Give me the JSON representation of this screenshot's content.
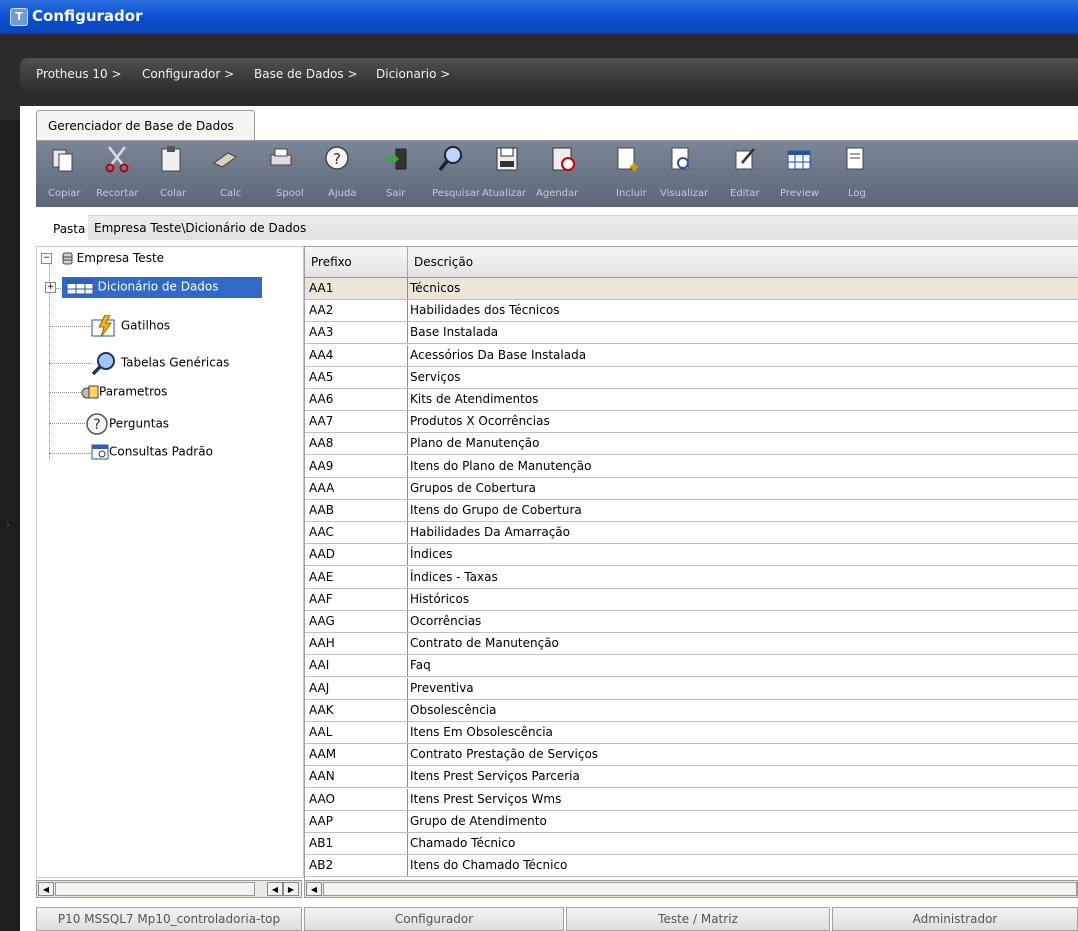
{
  "window": {
    "title": "Configurador"
  },
  "breadcrumb": [
    "Protheus 10 >",
    "Configurador >",
    "Base de Dados >",
    "Dicionario >"
  ],
  "tab": {
    "label": "Gerenciador de Base de Dados"
  },
  "toolbar": {
    "buttons": [
      {
        "label": "Copiar",
        "icon": "copy-icon"
      },
      {
        "label": "Recortar",
        "icon": "scissors-icon"
      },
      {
        "label": "Colar",
        "icon": "paste-icon"
      },
      {
        "label": "Calc",
        "icon": "calculator-icon"
      },
      {
        "label": "Spool",
        "icon": "printer-icon"
      },
      {
        "label": "Ajuda",
        "icon": "help-icon"
      },
      {
        "label": "Sair",
        "icon": "exit-icon"
      },
      {
        "label": "Pesquisar",
        "icon": "search-icon"
      },
      {
        "label": "Atualizar",
        "icon": "save-icon"
      },
      {
        "label": "Agendar",
        "icon": "schedule-icon"
      },
      {
        "label": "Incluir",
        "icon": "add-doc-icon"
      },
      {
        "label": "Visualizar",
        "icon": "view-doc-icon"
      },
      {
        "label": "Editar",
        "icon": "edit-icon"
      },
      {
        "label": "Preview",
        "icon": "grid-icon"
      },
      {
        "label": "Log",
        "icon": "log-icon"
      }
    ]
  },
  "pasta": {
    "label": "Pasta",
    "value": "Empresa Teste\\Dicionário de Dados"
  },
  "tree": {
    "root": "Empresa Teste",
    "items": [
      {
        "label": "Dicionário de Dados",
        "icon": "table-icon",
        "selected": true
      },
      {
        "label": "Gatilhos",
        "icon": "trigger-icon"
      },
      {
        "label": "Tabelas Genéricas",
        "icon": "search-icon"
      },
      {
        "label": "Parametros",
        "icon": "parameters-icon"
      },
      {
        "label": "Perguntas",
        "icon": "question-icon"
      },
      {
        "label": "Consultas Padrão",
        "icon": "query-icon"
      }
    ]
  },
  "grid": {
    "columns": [
      "Prefixo",
      "Descrição"
    ],
    "rows": [
      [
        "AA1",
        "Técnicos"
      ],
      [
        "AA2",
        "Habilidades dos Técnicos"
      ],
      [
        "AA3",
        "Base Instalada"
      ],
      [
        "AA4",
        "Acessórios Da Base Instalada"
      ],
      [
        "AA5",
        "Serviços"
      ],
      [
        "AA6",
        "Kits de Atendimentos"
      ],
      [
        "AA7",
        "Produtos X Ocorrências"
      ],
      [
        "AA8",
        "Plano de Manutenção"
      ],
      [
        "AA9",
        "Itens do Plano de Manutenção"
      ],
      [
        "AAA",
        "Grupos de Cobertura"
      ],
      [
        "AAB",
        "Itens do Grupo de Cobertura"
      ],
      [
        "AAC",
        "Habilidades Da Amarração"
      ],
      [
        "AAD",
        "Índices"
      ],
      [
        "AAE",
        "Índices - Taxas"
      ],
      [
        "AAF",
        "Históricos"
      ],
      [
        "AAG",
        "Ocorrências"
      ],
      [
        "AAH",
        "Contrato de Manutenção"
      ],
      [
        "AAI",
        "Faq"
      ],
      [
        "AAJ",
        "Preventiva"
      ],
      [
        "AAK",
        "Obsolescência"
      ],
      [
        "AAL",
        "Itens Em Obsolescência"
      ],
      [
        "AAM",
        "Contrato Prestação de Serviços"
      ],
      [
        "AAN",
        "Itens Prest Serviços Parceria"
      ],
      [
        "AAO",
        "Itens Prest Serviços Wms"
      ],
      [
        "AAP",
        "Grupo de Atendimento"
      ],
      [
        "AB1",
        "Chamado Técnico"
      ],
      [
        "AB2",
        "Itens do Chamado Técnico"
      ]
    ]
  },
  "statusbar": [
    "P10 MSSQL7 Mp10_controladoria-top",
    "Configurador",
    "Teste / Matriz",
    "Administrador"
  ],
  "colors": {
    "titlebar": "#0a4fd0",
    "selection": "#3169c6",
    "toolbar": "#6b7687",
    "dark_header": "#2b2b2b"
  }
}
